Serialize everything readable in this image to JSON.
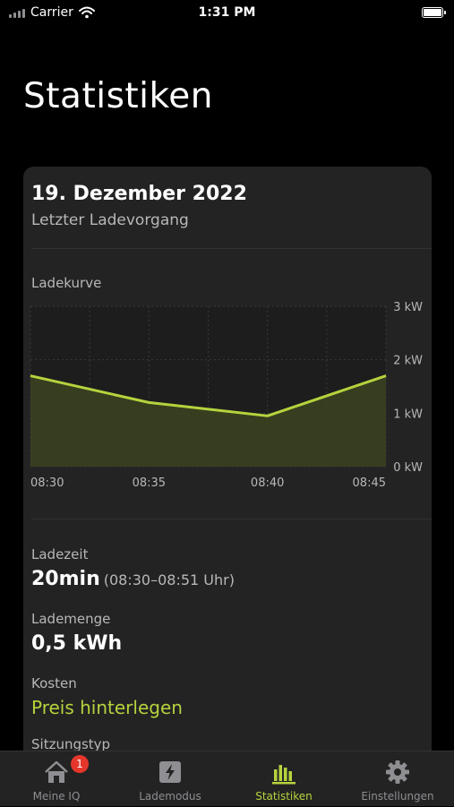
{
  "status_bar": {
    "carrier": "Carrier",
    "time": "1:31 PM"
  },
  "page": {
    "title": "Statistiken"
  },
  "card": {
    "date": "19. Dezember 2022",
    "subtitle": "Letzter Ladevorgang",
    "chart_label": "Ladekurve",
    "charging_time_label": "Ladezeit",
    "charging_time_value": "20min",
    "charging_time_range": "(08:30–08:51 Uhr)",
    "amount_label": "Lademenge",
    "amount_value": "0,5 kWh",
    "costs_label": "Kosten",
    "costs_link": "Preis hinterlegen",
    "session_type_label": "Sitzungstyp"
  },
  "chart_data": {
    "type": "area",
    "x": [
      "08:30",
      "08:35",
      "08:40",
      "08:45"
    ],
    "series": [
      {
        "values": [
          1.7,
          1.2,
          0.95,
          1.7
        ]
      }
    ],
    "x_ticks": [
      "08:30",
      "08:35",
      "08:40",
      "08:45"
    ],
    "y_ticks": [
      "0 kW",
      "1 kW",
      "2 kW",
      "3 kW"
    ],
    "ylim": [
      0,
      3
    ],
    "grid": true,
    "colors": {
      "line": "#b5d33d",
      "fill": "#3a4320"
    }
  },
  "tab_bar": {
    "items": [
      {
        "label": "Meine IQ",
        "icon": "home-icon",
        "badge": "1"
      },
      {
        "label": "Lademodus",
        "icon": "lightning-icon"
      },
      {
        "label": "Statistiken",
        "icon": "bar-chart-icon"
      },
      {
        "label": "Einstellungen",
        "icon": "gear-icon"
      }
    ],
    "active_color": "#b5d33d",
    "inactive_color": "#8e8e93"
  }
}
